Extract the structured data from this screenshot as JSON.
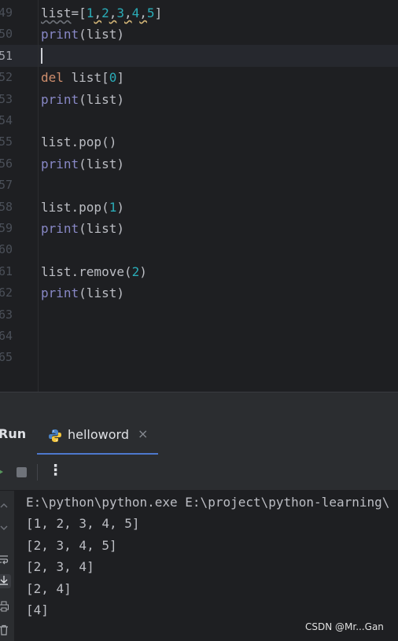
{
  "editor": {
    "line_numbers": [
      "49",
      "50",
      "51",
      "52",
      "53",
      "54",
      "55",
      "56",
      "57",
      "58",
      "59",
      "60",
      "61",
      "62",
      "63",
      "64",
      "65"
    ],
    "current_line": "51",
    "lines": [
      {
        "tokens": [
          [
            "ident-u",
            "list"
          ],
          [
            "plain",
            "=["
          ],
          [
            "num",
            "1"
          ],
          [
            "comma-u",
            ","
          ],
          [
            "num",
            "2"
          ],
          [
            "comma-u",
            ","
          ],
          [
            "num",
            "3"
          ],
          [
            "comma-u",
            ","
          ],
          [
            "num",
            "4"
          ],
          [
            "comma-u",
            ","
          ],
          [
            "num",
            "5"
          ],
          [
            "plain",
            "]"
          ]
        ]
      },
      {
        "tokens": [
          [
            "fn",
            "print"
          ],
          [
            "plain",
            "(list)"
          ]
        ]
      },
      {
        "tokens": []
      },
      {
        "tokens": [
          [
            "kw",
            "del"
          ],
          [
            "plain",
            " list["
          ],
          [
            "num",
            "0"
          ],
          [
            "plain",
            "]"
          ]
        ]
      },
      {
        "tokens": [
          [
            "fn",
            "print"
          ],
          [
            "plain",
            "(list)"
          ]
        ]
      },
      {
        "tokens": []
      },
      {
        "tokens": [
          [
            "plain",
            "list.pop()"
          ]
        ]
      },
      {
        "tokens": [
          [
            "fn",
            "print"
          ],
          [
            "plain",
            "(list)"
          ]
        ]
      },
      {
        "tokens": []
      },
      {
        "tokens": [
          [
            "plain",
            "list.pop("
          ],
          [
            "num",
            "1"
          ],
          [
            "plain",
            ")"
          ]
        ]
      },
      {
        "tokens": [
          [
            "fn",
            "print"
          ],
          [
            "plain",
            "(list)"
          ]
        ]
      },
      {
        "tokens": []
      },
      {
        "tokens": [
          [
            "plain",
            "list.remove("
          ],
          [
            "num",
            "2"
          ],
          [
            "plain",
            ")"
          ]
        ]
      },
      {
        "tokens": [
          [
            "fn",
            "print"
          ],
          [
            "plain",
            "(list)"
          ]
        ]
      },
      {
        "tokens": []
      },
      {
        "tokens": []
      },
      {
        "tokens": []
      }
    ]
  },
  "run_panel": {
    "title": "Run",
    "tab_label": "helloword",
    "tab_close": "×",
    "more_label": "⋮",
    "output": [
      "E:\\python\\python.exe E:\\project\\python-learning\\",
      "[1, 2, 3, 4, 5]",
      "[2, 3, 4, 5]",
      "[2, 3, 4]",
      "[2, 4]",
      "[4]"
    ]
  },
  "watermark": "CSDN @Mr...Gan",
  "colors": {
    "background": "#1e1f22",
    "keyword": "#cf8e6d",
    "builtin": "#8888c6",
    "number": "#2aacb8",
    "text": "#bcbec4",
    "tab_accent": "#4d78cc"
  }
}
